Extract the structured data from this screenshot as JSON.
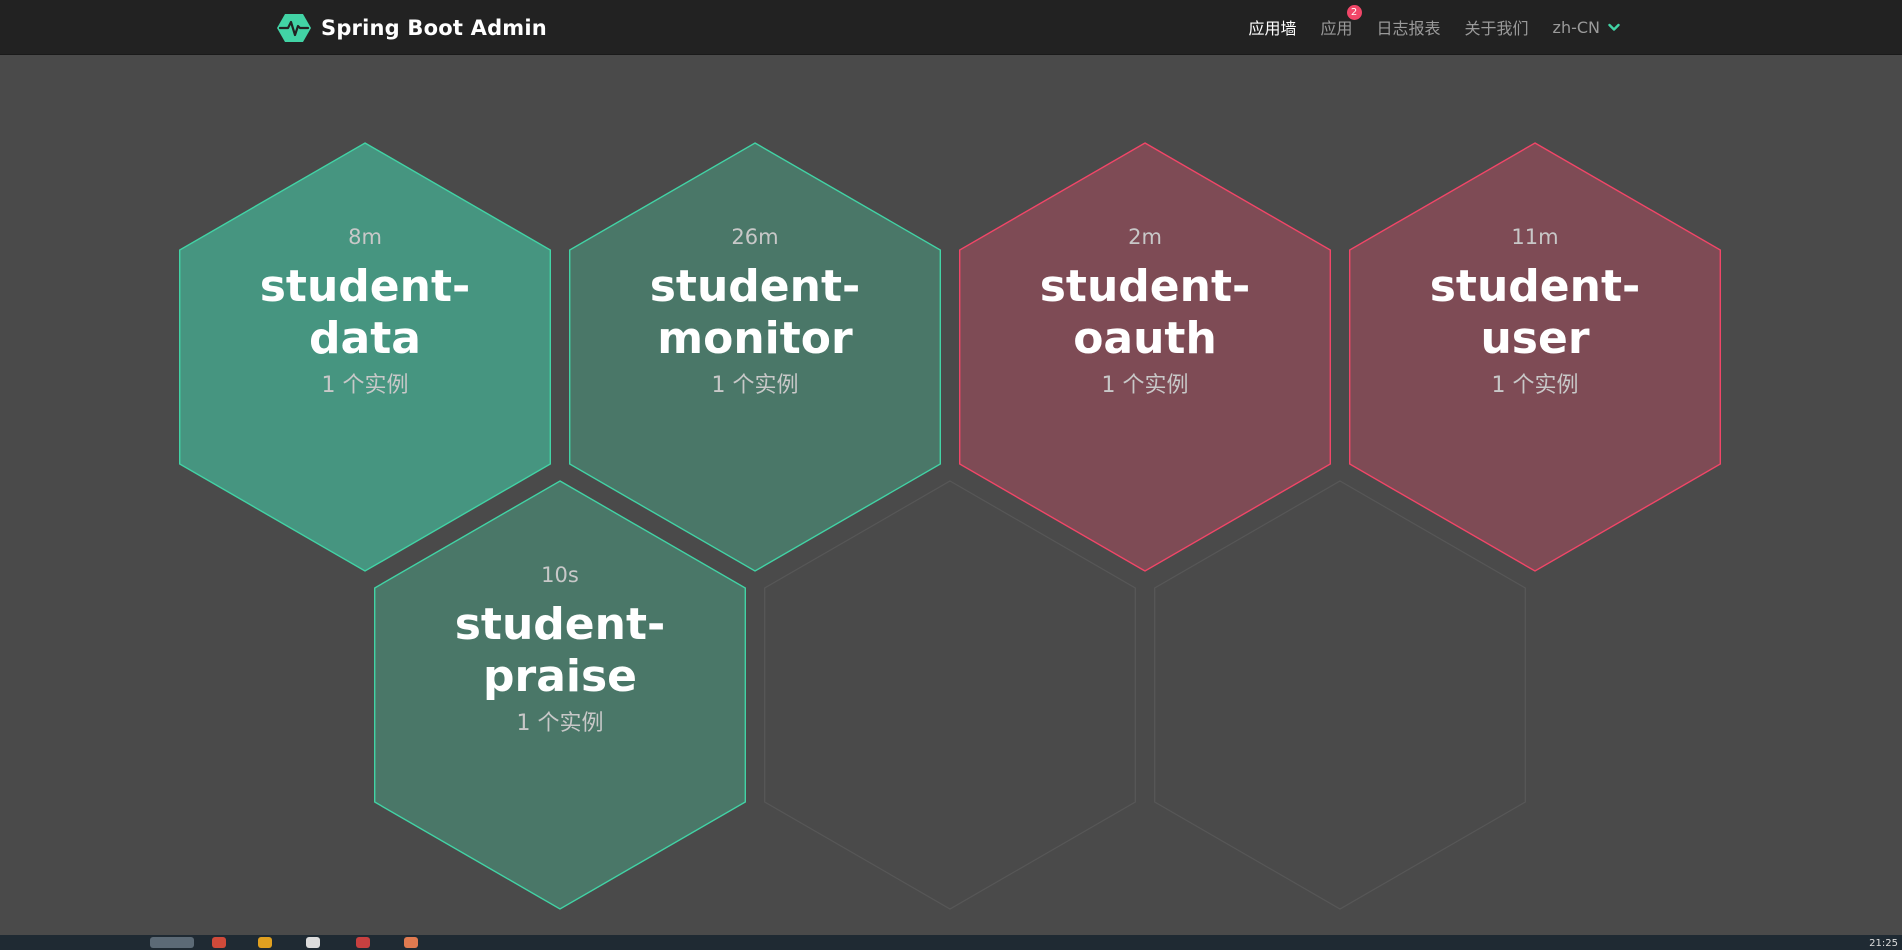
{
  "app": {
    "title": "Spring Boot Admin",
    "logo_icon": "heartbeat-hex-icon",
    "accent_color": "#42d3a5"
  },
  "nav": {
    "items": [
      {
        "label": "应用墙",
        "active": true
      },
      {
        "label": "应用",
        "badge": "2"
      },
      {
        "label": "日志报表"
      },
      {
        "label": "关于我们"
      }
    ],
    "language": "zh-CN"
  },
  "applications": [
    {
      "uptime": "8m",
      "name_line1": "student-",
      "name_line2": "data",
      "instances": "1 个实例",
      "status": "up",
      "fill": "#469580",
      "stroke": "#42d3a5"
    },
    {
      "uptime": "26m",
      "name_line1": "student-",
      "name_line2": "monitor",
      "instances": "1 个实例",
      "status": "up",
      "fill": "#4a7768",
      "stroke": "#42d3a5"
    },
    {
      "uptime": "2m",
      "name_line1": "student-",
      "name_line2": "oauth",
      "instances": "1 个实例",
      "status": "down",
      "fill": "#7e4b55",
      "stroke": "#f14668"
    },
    {
      "uptime": "11m",
      "name_line1": "student-",
      "name_line2": "user",
      "instances": "1 个实例",
      "status": "down",
      "fill": "#7e4b55",
      "stroke": "#f14668"
    },
    {
      "uptime": "10s",
      "name_line1": "student-",
      "name_line2": "praise",
      "instances": "1 个实例",
      "status": "up",
      "fill": "#4a7768",
      "stroke": "#42d3a5"
    }
  ],
  "placeholders": 2,
  "taskbar": {
    "clock": "21:25"
  }
}
